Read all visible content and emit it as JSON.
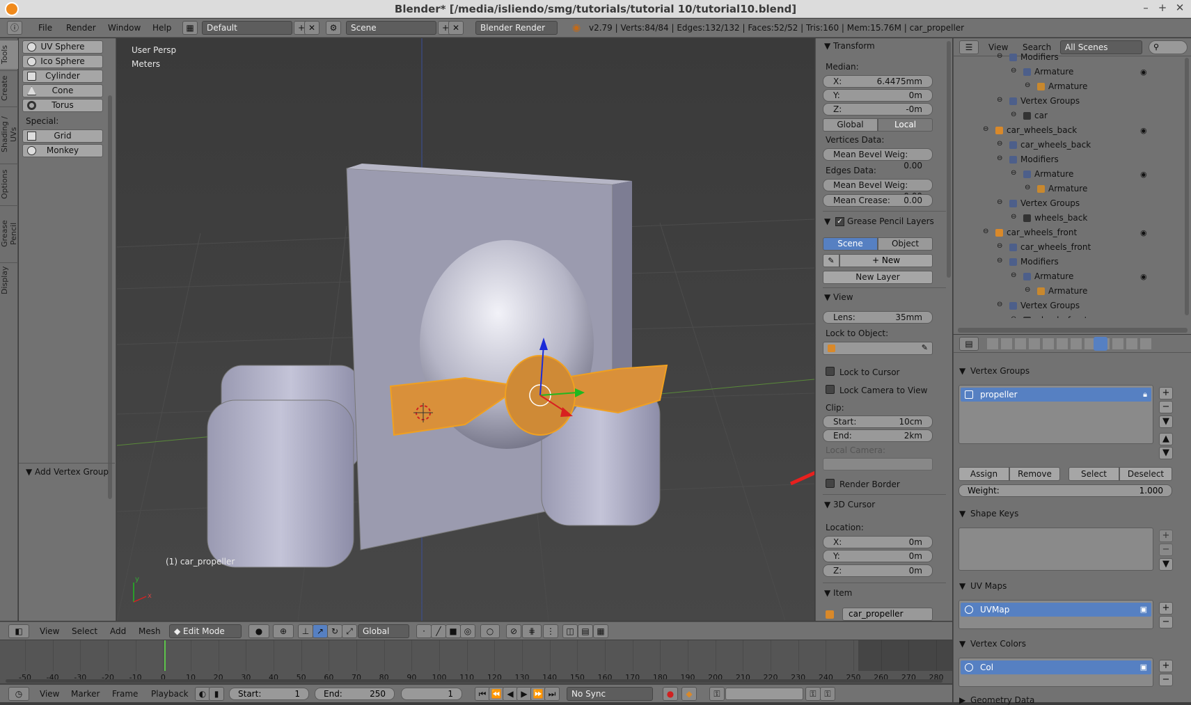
{
  "title_bar": {
    "title": "Blender* [/media/isliendo/smg/tutorials/tutorial 10/tutorial10.blend]",
    "min": "–",
    "max": "+",
    "close": "✕"
  },
  "info_header": {
    "menus": [
      "File",
      "Render",
      "Window",
      "Help"
    ],
    "layout": "Default",
    "scene": "Scene",
    "engine": "Blender Render",
    "stats": "v2.79 | Verts:84/84 | Edges:132/132 | Faces:52/52 | Tris:160 | Mem:15.76M | car_propeller"
  },
  "left_tabs": [
    "Tools",
    "Create",
    "Shading / UVs",
    "Options",
    "Grease Pencil",
    "Display"
  ],
  "tool_shelf": {
    "buttons": [
      "UV Sphere",
      "Ico Sphere",
      "Cylinder",
      "Cone",
      "Torus"
    ],
    "special_label": "Special:",
    "special_buttons": [
      "Grid",
      "Monkey"
    ],
    "operator_panel": "Add Vertex Group"
  },
  "viewport": {
    "view_name": "User Persp",
    "units": "Meters",
    "object_label": "(1) car_propeller",
    "axis_x": "x",
    "axis_y": "y"
  },
  "n_panel": {
    "transform": {
      "title": "Transform",
      "median": "Median:",
      "x_label": "X:",
      "x": "6.4475mm",
      "y_label": "Y:",
      "y": "0m",
      "z_label": "Z:",
      "z": "-0m",
      "global": "Global",
      "local": "Local",
      "vertices_data": "Vertices Data:",
      "mean_bevel_v_label": "Mean Bevel Weig:",
      "mean_bevel_v": "0.00",
      "edges_data": "Edges Data:",
      "mean_bevel_e_label": "Mean Bevel Weig:",
      "mean_bevel_e": "0.00",
      "mean_crease_label": "Mean Crease:",
      "mean_crease": "0.00"
    },
    "grease": {
      "title": "Grease Pencil Layers",
      "scene": "Scene",
      "object": "Object",
      "new": "New",
      "new_layer": "New Layer"
    },
    "view": {
      "title": "View",
      "lens_label": "Lens:",
      "lens": "35mm",
      "lock_object": "Lock to Object:",
      "lock_cursor": "Lock to Cursor",
      "lock_camera": "Lock Camera to View",
      "clip": "Clip:",
      "start_label": "Start:",
      "start": "10cm",
      "end_label": "End:",
      "end": "2km",
      "local_camera": "Local Camera:",
      "render_border": "Render Border"
    },
    "cursor": {
      "title": "3D Cursor",
      "location": "Location:",
      "x_label": "X:",
      "x": "0m",
      "y_label": "Y:",
      "y": "0m",
      "z_label": "Z:",
      "z": "0m"
    },
    "item": {
      "title": "Item",
      "name": "car_propeller"
    }
  },
  "outliner": {
    "view": "View",
    "search": "Search",
    "filter": "All Scenes",
    "rows": [
      {
        "name": "Modifiers",
        "indent": 80,
        "color": "#4d5f8a"
      },
      {
        "name": "Armature",
        "indent": 100,
        "color": "#4d5f8a"
      },
      {
        "name": "Armature",
        "indent": 120,
        "color": "#c8882e"
      },
      {
        "name": "Vertex Groups",
        "indent": 80,
        "color": "#4d5f8a"
      },
      {
        "name": "car",
        "indent": 100,
        "color": "#333333"
      },
      {
        "name": "car_wheels_back",
        "indent": 60,
        "color": "#d9892a"
      },
      {
        "name": "car_wheels_back",
        "indent": 80,
        "color": "#4d5f8a"
      },
      {
        "name": "Modifiers",
        "indent": 80,
        "color": "#4d5f8a"
      },
      {
        "name": "Armature",
        "indent": 100,
        "color": "#4d5f8a"
      },
      {
        "name": "Armature",
        "indent": 120,
        "color": "#c8882e"
      },
      {
        "name": "Vertex Groups",
        "indent": 80,
        "color": "#4d5f8a"
      },
      {
        "name": "wheels_back",
        "indent": 100,
        "color": "#333333"
      },
      {
        "name": "car_wheels_front",
        "indent": 60,
        "color": "#d9892a"
      },
      {
        "name": "car_wheels_front",
        "indent": 80,
        "color": "#4d5f8a"
      },
      {
        "name": "Modifiers",
        "indent": 80,
        "color": "#4d5f8a"
      },
      {
        "name": "Armature",
        "indent": 100,
        "color": "#4d5f8a"
      },
      {
        "name": "Armature",
        "indent": 120,
        "color": "#c8882e"
      },
      {
        "name": "Vertex Groups",
        "indent": 80,
        "color": "#4d5f8a"
      },
      {
        "name": "wheels_front",
        "indent": 100,
        "color": "#333333"
      }
    ]
  },
  "properties": {
    "vertex_groups": {
      "title": "Vertex Groups",
      "selected": "propeller",
      "assign": "Assign",
      "remove": "Remove",
      "select": "Select",
      "deselect": "Deselect",
      "weight_label": "Weight:",
      "weight": "1.000"
    },
    "shape_keys": {
      "title": "Shape Keys"
    },
    "uv_maps": {
      "title": "UV Maps",
      "selected": "UVMap"
    },
    "vertex_colors": {
      "title": "Vertex Colors",
      "selected": "Col"
    },
    "geometry_data": {
      "title": "Geometry Data"
    }
  },
  "view3d_header": {
    "menus": [
      "View",
      "Select",
      "Add",
      "Mesh"
    ],
    "mode": "Edit Mode",
    "orientation": "Global"
  },
  "timeline": {
    "ticks": [
      "-50",
      "-40",
      "-30",
      "-20",
      "-10",
      "0",
      "10",
      "20",
      "30",
      "40",
      "50",
      "60",
      "70",
      "80",
      "90",
      "100",
      "110",
      "120",
      "130",
      "140",
      "150",
      "160",
      "170",
      "180",
      "190",
      "200",
      "210",
      "220",
      "230",
      "240",
      "250",
      "260",
      "270",
      "280"
    ],
    "current_frame": "1",
    "start_label": "Start:",
    "start": "1",
    "end_label": "End:",
    "end": "250",
    "sync": "No Sync",
    "menus": [
      "View",
      "Marker",
      "Frame",
      "Playback"
    ]
  },
  "colors": {
    "select_blue": "#5680c2",
    "annotation_red": "#e8201e",
    "selection_orange": "#e89a2c"
  }
}
